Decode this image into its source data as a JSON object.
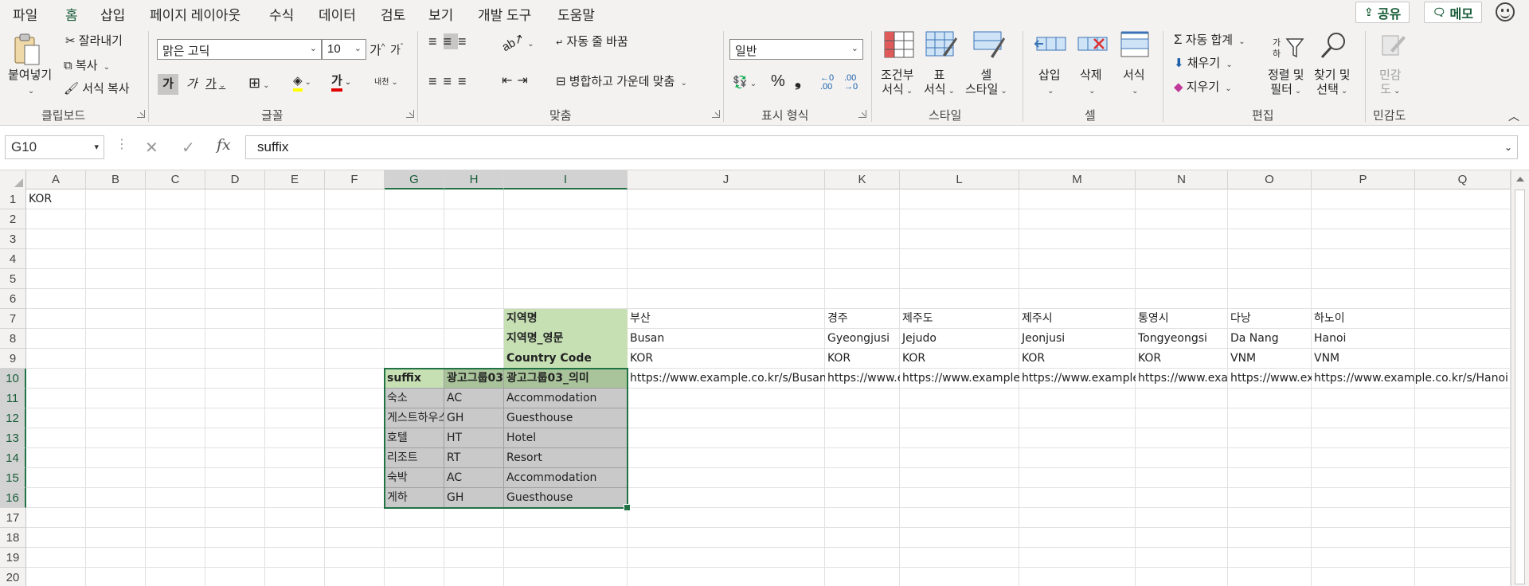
{
  "menu": {
    "tabs": [
      "파일",
      "홈",
      "삽입",
      "페이지 레이아웃",
      "수식",
      "데이터",
      "검토",
      "보기",
      "개발 도구",
      "도움말"
    ],
    "active_tab": "홈",
    "share_label": "공유",
    "memo_label": "메모"
  },
  "ribbon": {
    "clipboard": {
      "paste_label": "붙여넣기",
      "cut_label": "잘라내기",
      "copy_label": "복사",
      "format_painter_label": "서식 복사",
      "group_label": "클립보드"
    },
    "font": {
      "font_name": "맑은 고딕",
      "font_size": "10",
      "bold_glyph": "가",
      "italic_glyph": "가",
      "underline_glyph": "가",
      "font_color_glyph": "가",
      "phonetic_glyph": "내천",
      "grow_glyph": "가",
      "shrink_glyph": "가",
      "group_label": "글꼴"
    },
    "alignment": {
      "wrap_label": "자동 줄 바꿈",
      "merge_label": "병합하고 가운데 맞춤",
      "group_label": "맞춤"
    },
    "number": {
      "format": "일반",
      "percent_glyph": "%",
      "comma_glyph": "❟",
      "group_label": "표시 형식"
    },
    "styles": {
      "conditional_label_1": "조건부",
      "conditional_label_2": "서식",
      "table_label_1": "표",
      "table_label_2": "서식",
      "cell_style_label_1": "셀",
      "cell_style_label_2": "스타일",
      "group_label": "스타일"
    },
    "cells": {
      "insert_label": "삽입",
      "delete_label": "삭제",
      "format_label": "서식",
      "group_label": "셀"
    },
    "editing": {
      "autosum_label": "자동 합계",
      "fill_label": "채우기",
      "clear_label": "지우기",
      "sort_label_1": "정렬 및",
      "sort_label_2": "필터",
      "find_label_1": "찾기 및",
      "find_label_2": "선택",
      "group_label": "편집"
    },
    "sensitivity": {
      "label_1": "민감",
      "label_2": "도",
      "group_label": "민감도"
    }
  },
  "formula_bar": {
    "name_box": "G10",
    "fx_glyph": "fx",
    "value": "suffix"
  },
  "sheet": {
    "columns": [
      "A",
      "B",
      "C",
      "D",
      "E",
      "F",
      "G",
      "H",
      "I",
      "J",
      "K",
      "L",
      "M",
      "N",
      "O",
      "P",
      "Q"
    ],
    "rows": [
      "1",
      "2",
      "3",
      "4",
      "5",
      "6",
      "7",
      "8",
      "9",
      "10",
      "11",
      "12",
      "13",
      "14",
      "15",
      "16",
      "17",
      "18",
      "19",
      "20"
    ],
    "selected_columns": [
      "G",
      "H",
      "I"
    ],
    "selected_rows": [
      "10",
      "11",
      "12",
      "13",
      "14",
      "15",
      "16"
    ],
    "cells": [
      {
        "ref": "A1",
        "value": "KOR"
      },
      {
        "ref": "I7",
        "value": "지역명",
        "style": "label"
      },
      {
        "ref": "J7",
        "value": "부산"
      },
      {
        "ref": "K7",
        "value": "경주"
      },
      {
        "ref": "L7",
        "value": "제주도"
      },
      {
        "ref": "M7",
        "value": "제주시"
      },
      {
        "ref": "N7",
        "value": "통영시"
      },
      {
        "ref": "O7",
        "value": "다낭"
      },
      {
        "ref": "P7",
        "value": "하노이"
      },
      {
        "ref": "I8",
        "value": "지역명_영문",
        "style": "label"
      },
      {
        "ref": "J8",
        "value": "Busan"
      },
      {
        "ref": "K8",
        "value": "Gyeongjusi"
      },
      {
        "ref": "L8",
        "value": "Jejudo"
      },
      {
        "ref": "M8",
        "value": "Jeonjusi"
      },
      {
        "ref": "N8",
        "value": "Tongyeongsi"
      },
      {
        "ref": "O8",
        "value": "Da Nang"
      },
      {
        "ref": "P8",
        "value": "Hanoi"
      },
      {
        "ref": "I9",
        "value": "Country Code",
        "style": "label"
      },
      {
        "ref": "J9",
        "value": "KOR"
      },
      {
        "ref": "K9",
        "value": "KOR"
      },
      {
        "ref": "L9",
        "value": "KOR"
      },
      {
        "ref": "M9",
        "value": "KOR"
      },
      {
        "ref": "N9",
        "value": "KOR"
      },
      {
        "ref": "O9",
        "value": "VNM"
      },
      {
        "ref": "P9",
        "value": "VNM"
      },
      {
        "ref": "G10",
        "value": "suffix",
        "style": "header-green"
      },
      {
        "ref": "H10",
        "value": "광고그룹03",
        "style": "header-green"
      },
      {
        "ref": "I10",
        "value": "광고그룹03_의미",
        "style": "header-green"
      },
      {
        "ref": "J10",
        "value": "https://www.example.co.kr/s/Busan"
      },
      {
        "ref": "K10",
        "value": "https://www.example.co.kr/s/Gyeongjusi"
      },
      {
        "ref": "L10",
        "value": "https://www.example.co.kr/s/Jejudo"
      },
      {
        "ref": "M10",
        "value": "https://www.example.co.kr/s/Jeonjusi"
      },
      {
        "ref": "N10",
        "value": "https://www.example.co.kr/s/Tongyeongsi"
      },
      {
        "ref": "O10",
        "value": "https://www.example.co.kr/s/Da Nang"
      },
      {
        "ref": "P10",
        "value": "https://www.example.co.kr/s/Hanoi"
      },
      {
        "ref": "G11",
        "value": "숙소",
        "style": "body-gray"
      },
      {
        "ref": "H11",
        "value": "AC",
        "style": "body-gray"
      },
      {
        "ref": "I11",
        "value": "Accommodation",
        "style": "body-gray"
      },
      {
        "ref": "G12",
        "value": "게스트하우스",
        "style": "body-gray"
      },
      {
        "ref": "H12",
        "value": "GH",
        "style": "body-gray"
      },
      {
        "ref": "I12",
        "value": "Guesthouse",
        "style": "body-gray"
      },
      {
        "ref": "G13",
        "value": "호텔",
        "style": "body-gray"
      },
      {
        "ref": "H13",
        "value": "HT",
        "style": "body-gray"
      },
      {
        "ref": "I13",
        "value": "Hotel",
        "style": "body-gray"
      },
      {
        "ref": "G14",
        "value": "리조트",
        "style": "body-gray"
      },
      {
        "ref": "H14",
        "value": "RT",
        "style": "body-gray"
      },
      {
        "ref": "I14",
        "value": "Resort",
        "style": "body-gray"
      },
      {
        "ref": "G15",
        "value": "숙박",
        "style": "body-gray"
      },
      {
        "ref": "H15",
        "value": "AC",
        "style": "body-gray"
      },
      {
        "ref": "I15",
        "value": "Accommodation",
        "style": "body-gray"
      },
      {
        "ref": "G16",
        "value": "게하",
        "style": "body-gray"
      },
      {
        "ref": "H16",
        "value": "GH",
        "style": "body-gray"
      },
      {
        "ref": "I16",
        "value": "Guesthouse",
        "style": "body-gray"
      }
    ]
  },
  "colors": {
    "accent": "#217346",
    "label_fill": "#c6e0b4",
    "body_fill": "#c9c9c9"
  }
}
